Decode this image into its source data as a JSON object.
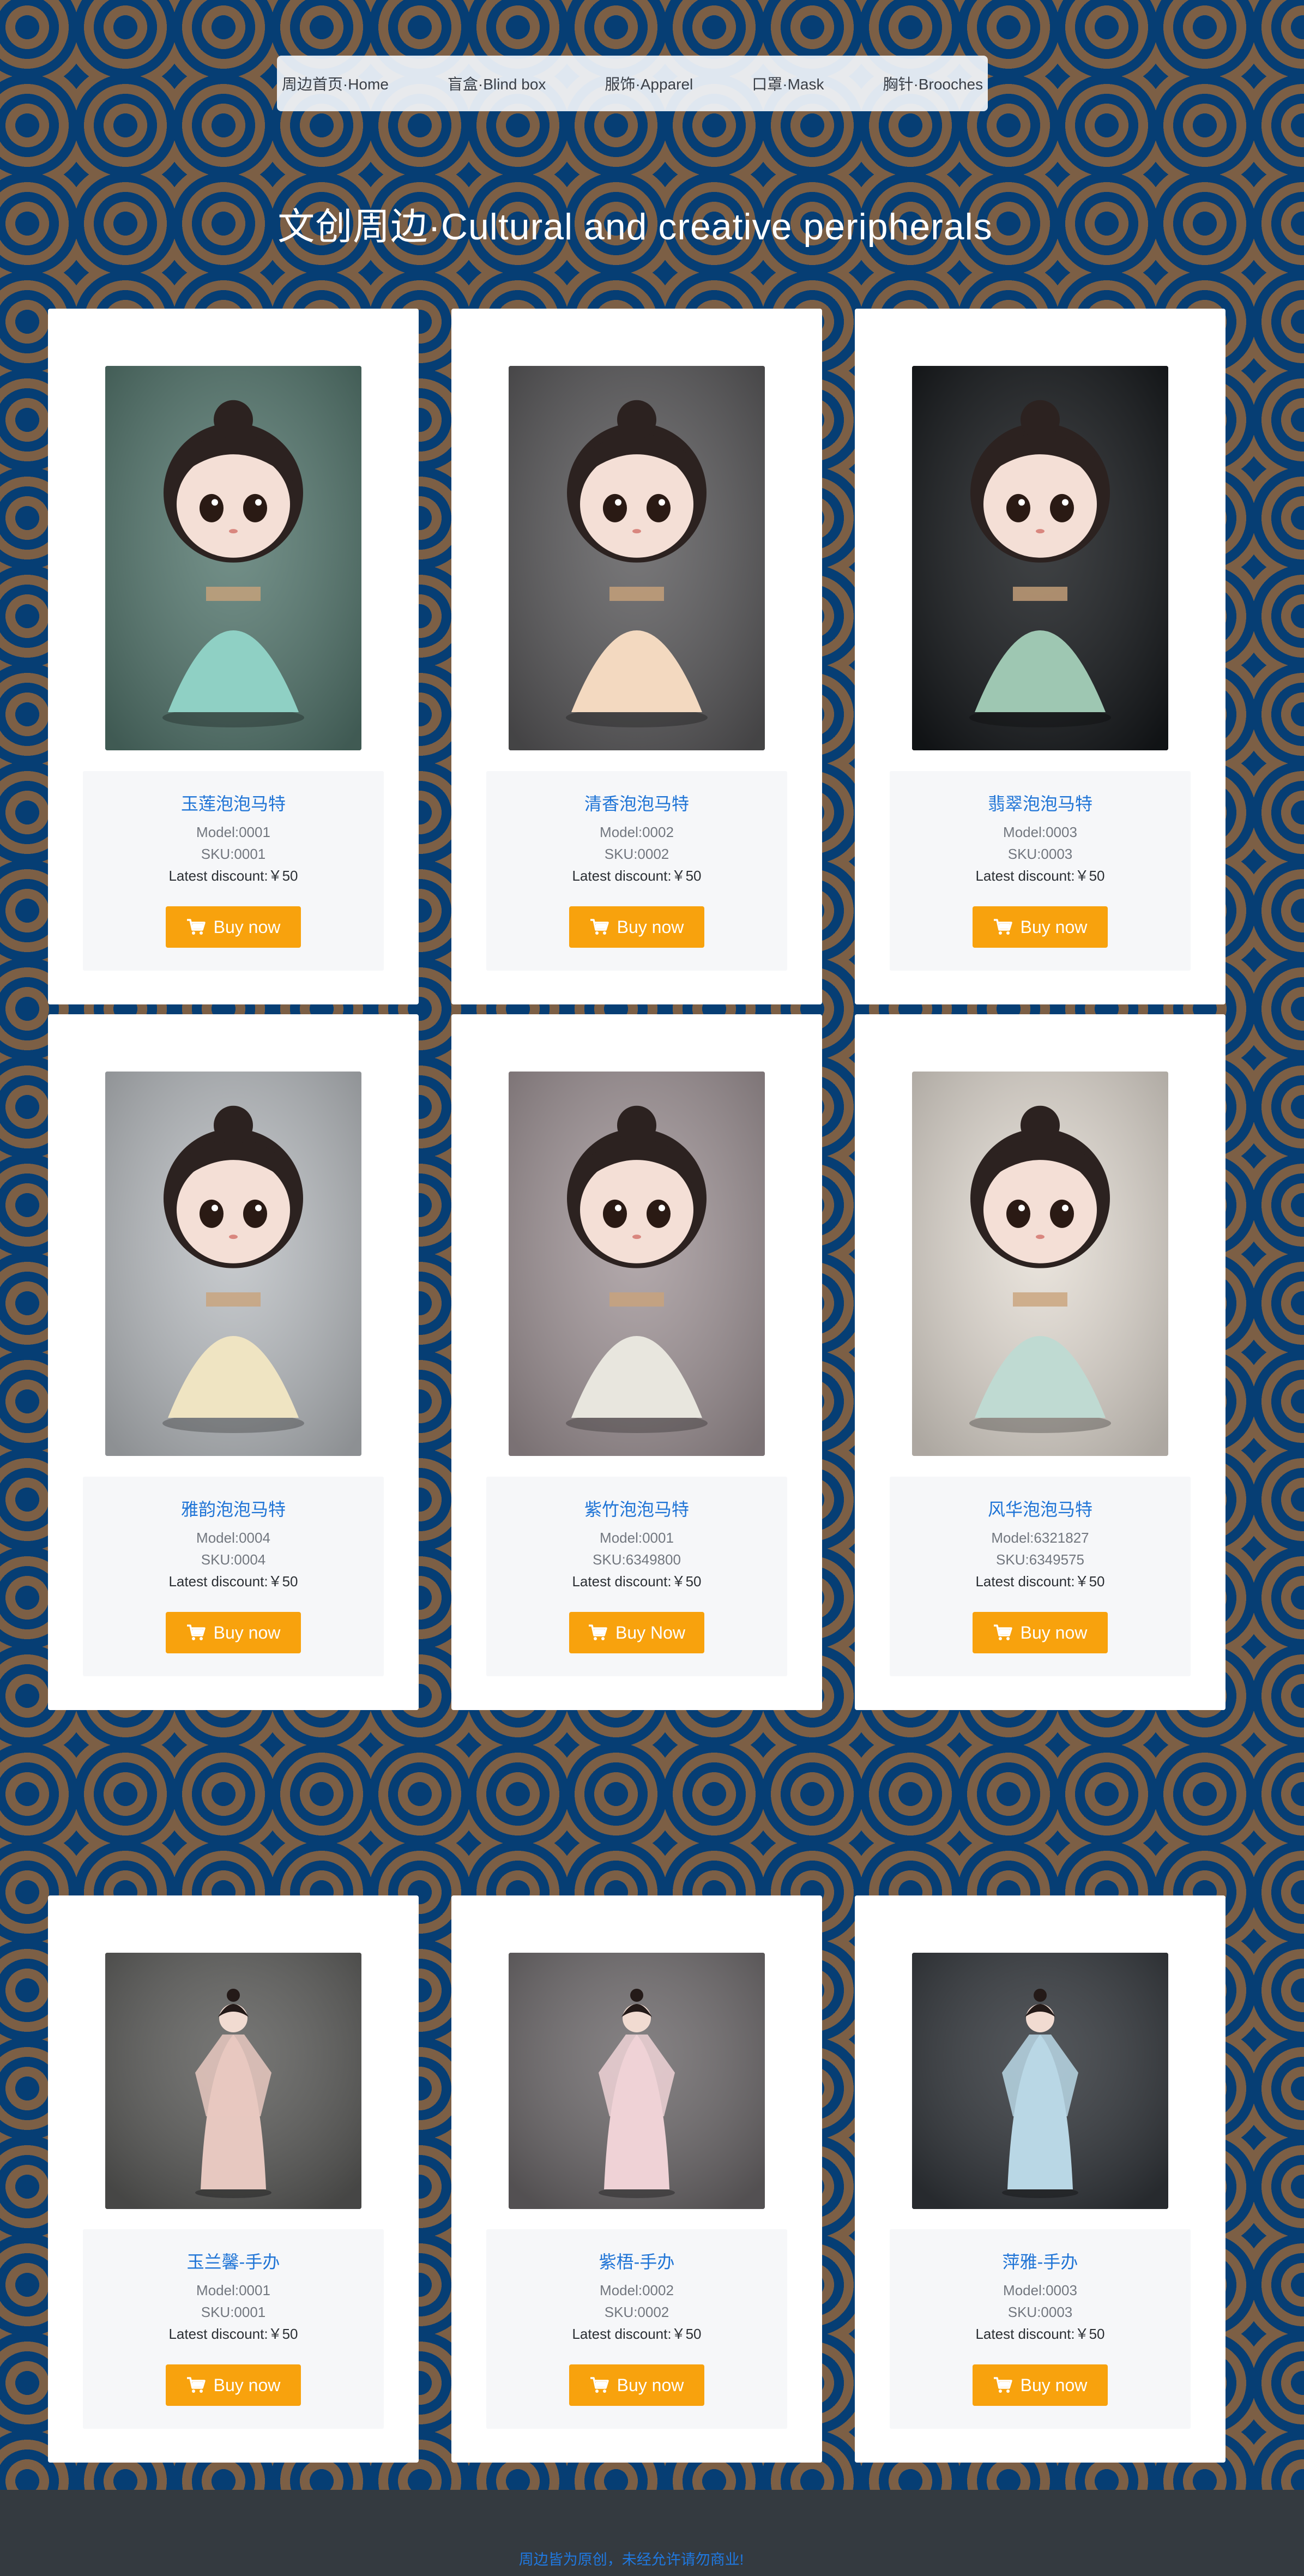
{
  "nav": {
    "items": [
      {
        "label": "周边首页·Home"
      },
      {
        "label": "盲盒·Blind box"
      },
      {
        "label": "服饰·Apparel"
      },
      {
        "label": "口罩·Mask"
      },
      {
        "label": "胸针·Brooches"
      }
    ]
  },
  "page": {
    "title": "文创周边·Cultural and creative peripherals"
  },
  "products": [
    {
      "name": "玉莲泡泡马特",
      "model": "Model:0001",
      "sku": "SKU:0001",
      "price": "Latest discount:￥50",
      "button": "Buy now",
      "accent": "#8fd0c4",
      "bg": "#55786f"
    },
    {
      "name": "清香泡泡马特",
      "model": "Model:0002",
      "sku": "SKU:0002",
      "price": "Latest discount:￥50",
      "button": "Buy now",
      "accent": "#f3d9c0",
      "bg": "#5b5a5c"
    },
    {
      "name": "翡翠泡泡马特",
      "model": "Model:0003",
      "sku": "SKU:0003",
      "price": "Latest discount:￥50",
      "button": "Buy now",
      "accent": "#9ec7b2",
      "bg": "#16191c"
    },
    {
      "name": "雅韵泡泡马特",
      "model": "Model:0004",
      "sku": "SKU:0004",
      "price": "Latest discount:￥50",
      "button": "Buy now",
      "accent": "#efe4c2",
      "bg": "#bcc0c4"
    },
    {
      "name": "紫竹泡泡马特",
      "model": "Model:0001",
      "sku": "SKU:6349800",
      "price": "Latest discount:￥50",
      "button": "Buy Now",
      "accent": "#e8e6de",
      "bg": "#a3979a"
    },
    {
      "name": "风华泡泡马特",
      "model": "Model:6321827",
      "sku": "SKU:6349575",
      "price": "Latest discount:￥50",
      "button": "Buy now",
      "accent": "#bfdad2",
      "bg": "#e6dfd6"
    },
    {
      "name": "玉兰馨-手办",
      "model": "Model:0001",
      "sku": "SKU:0001",
      "price": "Latest discount:￥50",
      "button": "Buy now",
      "accent": "#e7c8c0",
      "bg": "#5e5e5c"
    },
    {
      "name": "紫梧-手办",
      "model": "Model:0002",
      "sku": "SKU:0002",
      "price": "Latest discount:￥50",
      "button": "Buy now",
      "accent": "#efd2d6",
      "bg": "#6f6b6d"
    },
    {
      "name": "萍雅-手办",
      "model": "Model:0003",
      "sku": "SKU:0003",
      "price": "Latest discount:￥50",
      "button": "Buy now",
      "accent": "#b9d7e5",
      "bg": "#34383d"
    }
  ],
  "footer": {
    "text": "周边皆为原创，未经允许请勿商业!"
  }
}
